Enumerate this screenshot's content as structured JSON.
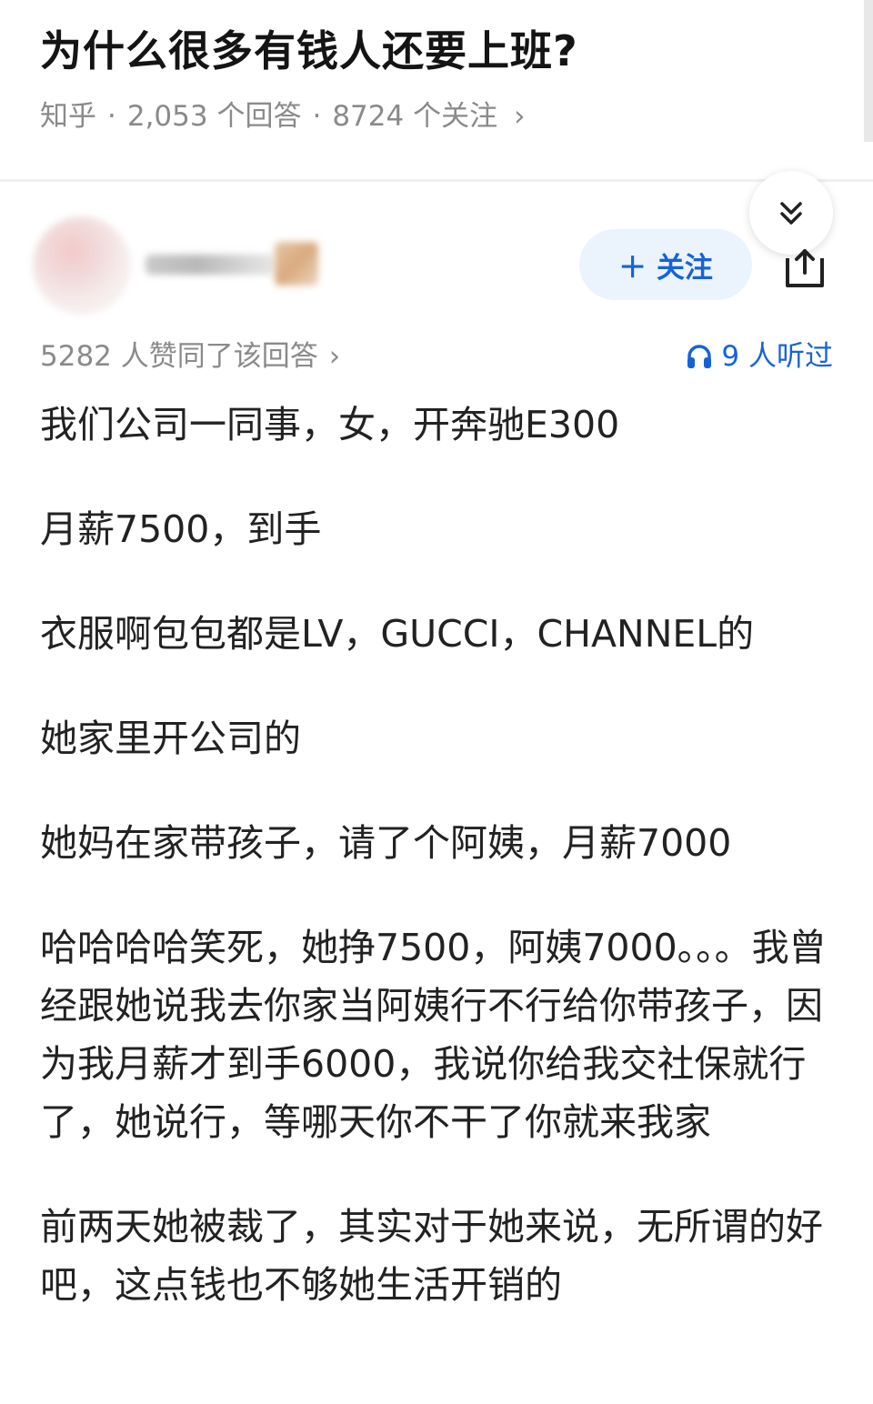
{
  "question": {
    "title": "为什么很多有钱人还要上班?",
    "source": "知乎",
    "separator": "·",
    "answer_count": "2,053 个回答",
    "follower_count": "8724 个关注",
    "chevron": "›"
  },
  "answer_header": {
    "follow_label": "＋ 关注",
    "approval_text": "5282 人赞同了该回答",
    "approval_chevron": "›",
    "listen_count": "9 人听过",
    "icons": [
      "chevron-double-down-icon",
      "share-icon",
      "headphones-icon"
    ],
    "accent_color": "#1763d6"
  },
  "answer": {
    "paragraphs": [
      "我们公司一同事，女，开奔驰E300",
      "月薪7500，到手",
      "衣服啊包包都是LV，GUCCI，CHANNEL的",
      "她家里开公司的",
      "她妈在家带孩子，请了个阿姨，月薪7000",
      "哈哈哈哈笑死，她挣7500，阿姨7000。。。我曾经跟她说我去你家当阿姨行不行给你带孩子，因为我月薪才到手6000，我说你给我交社保就行了，她说行，等哪天你不干了你就来我家",
      "前两天她被裁了，其实对于她来说，无所谓的好吧，这点钱也不够她生活开销的"
    ]
  }
}
